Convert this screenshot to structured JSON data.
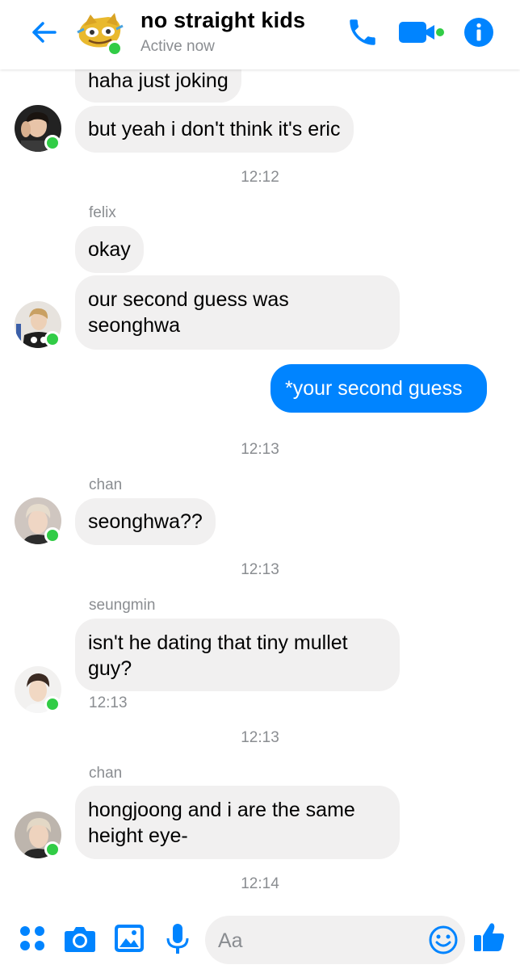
{
  "colors": {
    "accent": "#0084ff",
    "online": "#31cc46",
    "bubble_in": "#f1f0f0",
    "meta_text": "#8a8d91"
  },
  "header": {
    "title": "no straight kids",
    "status": "Active now",
    "icons": [
      "back-arrow-icon",
      "phone-icon",
      "video-camera-icon",
      "info-icon"
    ]
  },
  "messages": [
    {
      "text": "haha just joking"
    },
    {
      "text": "but yeah i don't think it's eric"
    },
    {
      "time": "12:12"
    },
    {
      "sender": "felix"
    },
    {
      "text": "okay"
    },
    {
      "lines": [
        "our second guess was",
        "seonghwa"
      ]
    },
    {
      "text": "*your second guess",
      "from_me": true
    },
    {
      "time": "12:13"
    },
    {
      "sender": "chan"
    },
    {
      "text": "seonghwa??"
    },
    {
      "time": "12:13"
    },
    {
      "sender": "seungmin"
    },
    {
      "lines": [
        "isn't he dating that tiny mullet",
        "guy?"
      ],
      "time": "12:13"
    },
    {
      "time": "12:13"
    },
    {
      "sender": "chan"
    },
    {
      "lines": [
        "hongjoong and i are the same",
        "height eye-"
      ]
    },
    {
      "time": "12:14"
    }
  ],
  "composer": {
    "placeholder": "Aa",
    "icons": [
      "more-apps-icon",
      "camera-icon",
      "gallery-icon",
      "microphone-icon",
      "emoji-icon",
      "thumbs-up-icon"
    ]
  }
}
